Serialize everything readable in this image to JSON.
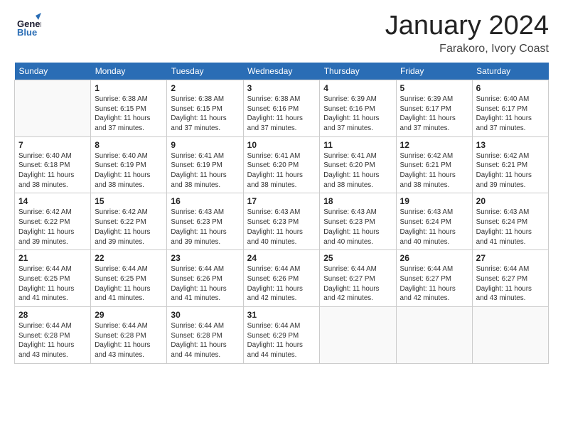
{
  "header": {
    "logo_general": "General",
    "logo_blue": "Blue",
    "month": "January 2024",
    "location": "Farakoro, Ivory Coast"
  },
  "days_of_week": [
    "Sunday",
    "Monday",
    "Tuesday",
    "Wednesday",
    "Thursday",
    "Friday",
    "Saturday"
  ],
  "weeks": [
    [
      {
        "day": "",
        "info": ""
      },
      {
        "day": "1",
        "info": "Sunrise: 6:38 AM\nSunset: 6:15 PM\nDaylight: 11 hours\nand 37 minutes."
      },
      {
        "day": "2",
        "info": "Sunrise: 6:38 AM\nSunset: 6:15 PM\nDaylight: 11 hours\nand 37 minutes."
      },
      {
        "day": "3",
        "info": "Sunrise: 6:38 AM\nSunset: 6:16 PM\nDaylight: 11 hours\nand 37 minutes."
      },
      {
        "day": "4",
        "info": "Sunrise: 6:39 AM\nSunset: 6:16 PM\nDaylight: 11 hours\nand 37 minutes."
      },
      {
        "day": "5",
        "info": "Sunrise: 6:39 AM\nSunset: 6:17 PM\nDaylight: 11 hours\nand 37 minutes."
      },
      {
        "day": "6",
        "info": "Sunrise: 6:40 AM\nSunset: 6:17 PM\nDaylight: 11 hours\nand 37 minutes."
      }
    ],
    [
      {
        "day": "7",
        "info": "Sunrise: 6:40 AM\nSunset: 6:18 PM\nDaylight: 11 hours\nand 38 minutes."
      },
      {
        "day": "8",
        "info": "Sunrise: 6:40 AM\nSunset: 6:19 PM\nDaylight: 11 hours\nand 38 minutes."
      },
      {
        "day": "9",
        "info": "Sunrise: 6:41 AM\nSunset: 6:19 PM\nDaylight: 11 hours\nand 38 minutes."
      },
      {
        "day": "10",
        "info": "Sunrise: 6:41 AM\nSunset: 6:20 PM\nDaylight: 11 hours\nand 38 minutes."
      },
      {
        "day": "11",
        "info": "Sunrise: 6:41 AM\nSunset: 6:20 PM\nDaylight: 11 hours\nand 38 minutes."
      },
      {
        "day": "12",
        "info": "Sunrise: 6:42 AM\nSunset: 6:21 PM\nDaylight: 11 hours\nand 38 minutes."
      },
      {
        "day": "13",
        "info": "Sunrise: 6:42 AM\nSunset: 6:21 PM\nDaylight: 11 hours\nand 39 minutes."
      }
    ],
    [
      {
        "day": "14",
        "info": "Sunrise: 6:42 AM\nSunset: 6:22 PM\nDaylight: 11 hours\nand 39 minutes."
      },
      {
        "day": "15",
        "info": "Sunrise: 6:42 AM\nSunset: 6:22 PM\nDaylight: 11 hours\nand 39 minutes."
      },
      {
        "day": "16",
        "info": "Sunrise: 6:43 AM\nSunset: 6:23 PM\nDaylight: 11 hours\nand 39 minutes."
      },
      {
        "day": "17",
        "info": "Sunrise: 6:43 AM\nSunset: 6:23 PM\nDaylight: 11 hours\nand 40 minutes."
      },
      {
        "day": "18",
        "info": "Sunrise: 6:43 AM\nSunset: 6:23 PM\nDaylight: 11 hours\nand 40 minutes."
      },
      {
        "day": "19",
        "info": "Sunrise: 6:43 AM\nSunset: 6:24 PM\nDaylight: 11 hours\nand 40 minutes."
      },
      {
        "day": "20",
        "info": "Sunrise: 6:43 AM\nSunset: 6:24 PM\nDaylight: 11 hours\nand 41 minutes."
      }
    ],
    [
      {
        "day": "21",
        "info": "Sunrise: 6:44 AM\nSunset: 6:25 PM\nDaylight: 11 hours\nand 41 minutes."
      },
      {
        "day": "22",
        "info": "Sunrise: 6:44 AM\nSunset: 6:25 PM\nDaylight: 11 hours\nand 41 minutes."
      },
      {
        "day": "23",
        "info": "Sunrise: 6:44 AM\nSunset: 6:26 PM\nDaylight: 11 hours\nand 41 minutes."
      },
      {
        "day": "24",
        "info": "Sunrise: 6:44 AM\nSunset: 6:26 PM\nDaylight: 11 hours\nand 42 minutes."
      },
      {
        "day": "25",
        "info": "Sunrise: 6:44 AM\nSunset: 6:27 PM\nDaylight: 11 hours\nand 42 minutes."
      },
      {
        "day": "26",
        "info": "Sunrise: 6:44 AM\nSunset: 6:27 PM\nDaylight: 11 hours\nand 42 minutes."
      },
      {
        "day": "27",
        "info": "Sunrise: 6:44 AM\nSunset: 6:27 PM\nDaylight: 11 hours\nand 43 minutes."
      }
    ],
    [
      {
        "day": "28",
        "info": "Sunrise: 6:44 AM\nSunset: 6:28 PM\nDaylight: 11 hours\nand 43 minutes."
      },
      {
        "day": "29",
        "info": "Sunrise: 6:44 AM\nSunset: 6:28 PM\nDaylight: 11 hours\nand 43 minutes."
      },
      {
        "day": "30",
        "info": "Sunrise: 6:44 AM\nSunset: 6:28 PM\nDaylight: 11 hours\nand 44 minutes."
      },
      {
        "day": "31",
        "info": "Sunrise: 6:44 AM\nSunset: 6:29 PM\nDaylight: 11 hours\nand 44 minutes."
      },
      {
        "day": "",
        "info": ""
      },
      {
        "day": "",
        "info": ""
      },
      {
        "day": "",
        "info": ""
      }
    ]
  ]
}
